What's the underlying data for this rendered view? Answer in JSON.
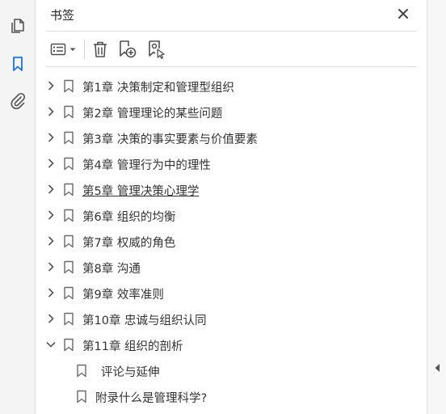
{
  "panel": {
    "title": "书签"
  },
  "bookmarks": [
    {
      "label": "第1章  决策制定和管理型组织",
      "level": 0,
      "expanded": false
    },
    {
      "label": "第2章  管理理论的某些问题",
      "level": 0,
      "expanded": false
    },
    {
      "label": "第3章  决策的事实要素与价值要素",
      "level": 0,
      "expanded": false
    },
    {
      "label": "第4章  管理行为中的理性",
      "level": 0,
      "expanded": false
    },
    {
      "label": "第5章  管理决策心理学",
      "level": 0,
      "expanded": false,
      "underlined": true
    },
    {
      "label": "第6章  组织的均衡",
      "level": 0,
      "expanded": false
    },
    {
      "label": "第7章  权威的角色",
      "level": 0,
      "expanded": false
    },
    {
      "label": "第8章  沟通",
      "level": 0,
      "expanded": false
    },
    {
      "label": "第9章  效率准则",
      "level": 0,
      "expanded": false
    },
    {
      "label": "第10章  忠诚与组织认同",
      "level": 0,
      "expanded": false
    },
    {
      "label": "第11章  组织的剖析",
      "level": 0,
      "expanded": true
    },
    {
      "label": "评论与延伸",
      "level": 1,
      "expanded": false
    },
    {
      "label": "附录什么是管理科学?",
      "level": 1,
      "expanded": false
    }
  ],
  "colors": {
    "accent": "#1473e6",
    "icon": "#505050"
  }
}
